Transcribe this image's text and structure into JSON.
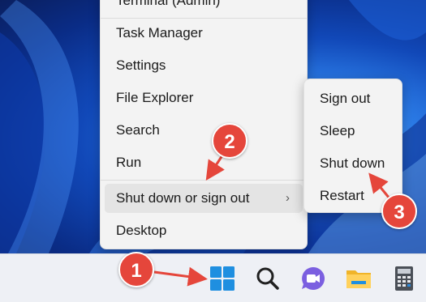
{
  "context_menu": {
    "items": [
      {
        "label": "Terminal (Admin)"
      },
      {
        "label": "Task Manager"
      },
      {
        "label": "Settings"
      },
      {
        "label": "File Explorer"
      },
      {
        "label": "Search"
      },
      {
        "label": "Run"
      },
      {
        "label": "Shut down or sign out",
        "chevron": "›"
      },
      {
        "label": "Desktop"
      }
    ]
  },
  "submenu": {
    "items": [
      {
        "label": "Sign out"
      },
      {
        "label": "Sleep"
      },
      {
        "label": "Shut down"
      },
      {
        "label": "Restart"
      }
    ]
  },
  "taskbar": {
    "icons": [
      "windows-start-icon",
      "search-icon",
      "chat-camera-icon",
      "file-explorer-folder-icon",
      "calculator-icon"
    ]
  },
  "annotations": {
    "badges": [
      "1",
      "2",
      "3"
    ],
    "color": "#e5463b"
  }
}
